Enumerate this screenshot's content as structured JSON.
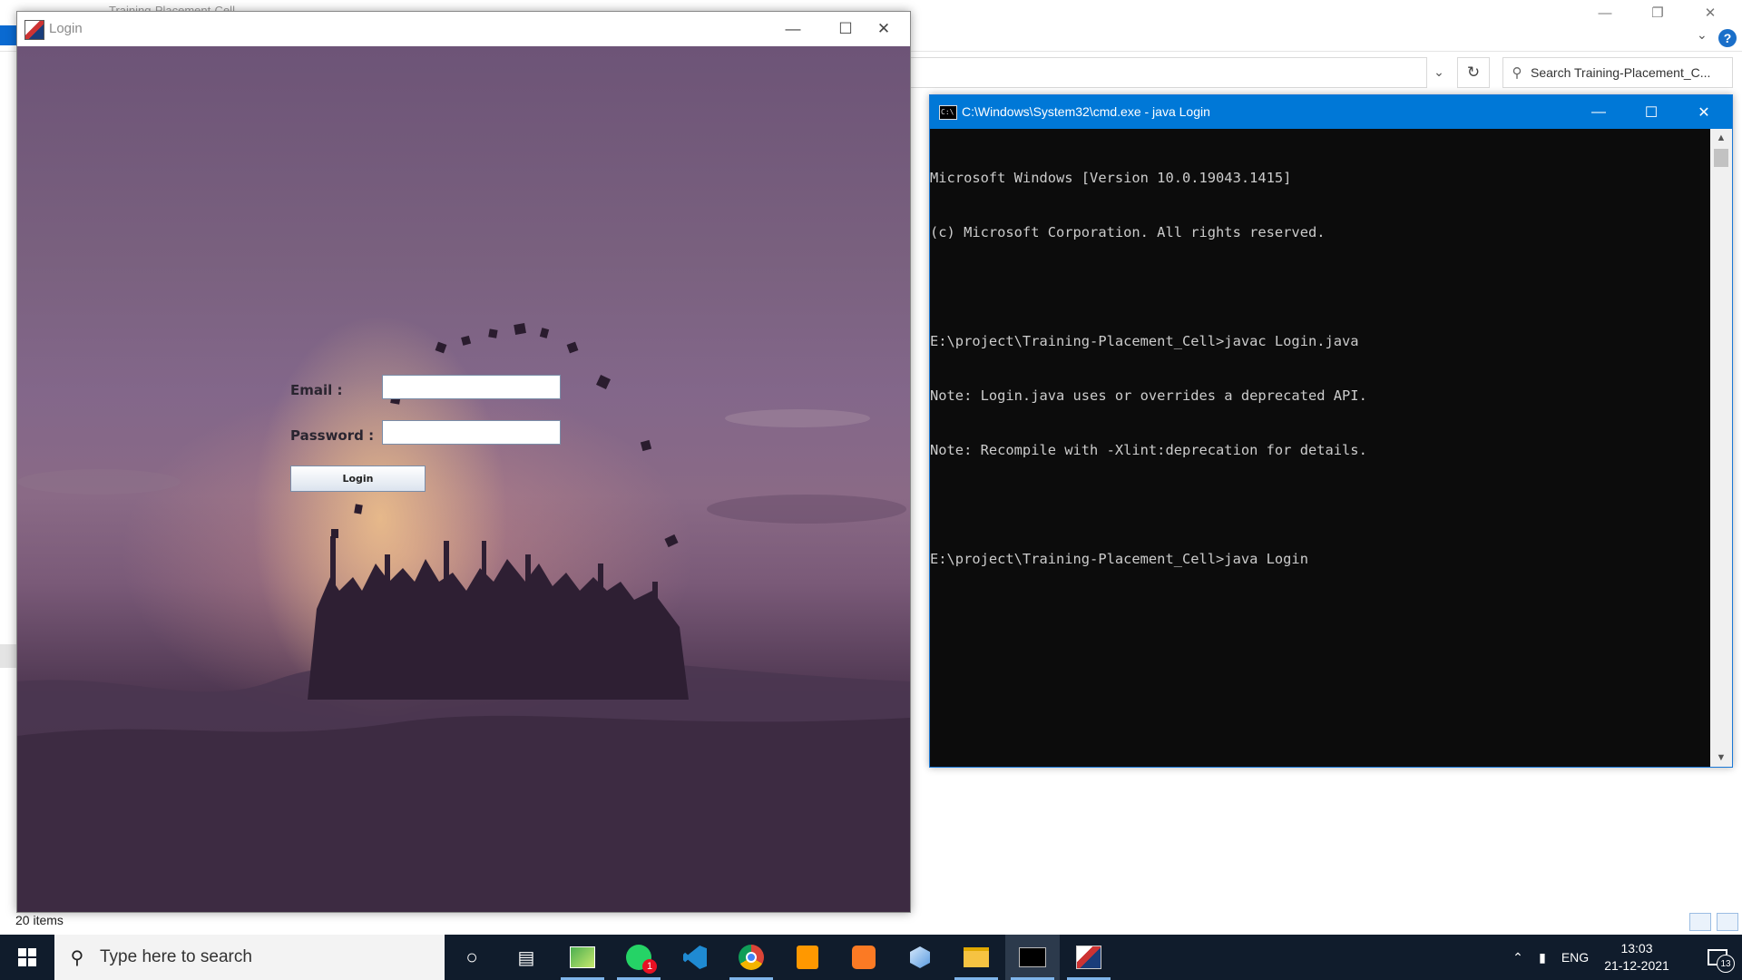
{
  "explorer": {
    "title": "Training-Placement-Cell",
    "search_placeholder": "Search Training-Placement_C...",
    "status": "20 items",
    "help": "?"
  },
  "login_window": {
    "title": "Login",
    "email_label": "Email :",
    "password_label": "Password :",
    "email_value": "",
    "password_value": "",
    "login_button": "Login"
  },
  "cmd_window": {
    "title": "C:\\Windows\\System32\\cmd.exe - java  Login",
    "lines": [
      "Microsoft Windows [Version 10.0.19043.1415]",
      "(c) Microsoft Corporation. All rights reserved.",
      "",
      "E:\\project\\Training-Placement_Cell>javac Login.java",
      "Note: Login.java uses or overrides a deprecated API.",
      "Note: Recompile with -Xlint:deprecation for details.",
      "",
      "E:\\project\\Training-Placement_Cell>java Login"
    ]
  },
  "taskbar": {
    "search_placeholder": "Type here to search",
    "whatsapp_badge": "1",
    "tray_lang": "ENG",
    "time": "13:03",
    "date": "21-12-2021",
    "notification_count": "13",
    "apps": [
      "cortana-icon",
      "task-view-icon",
      "image-editor-icon",
      "whatsapp-icon",
      "vscode-icon",
      "chrome-icon",
      "sublime-text-icon",
      "xampp-icon",
      "3d-box-icon",
      "file-explorer-icon",
      "cmd-icon",
      "java-icon"
    ]
  }
}
